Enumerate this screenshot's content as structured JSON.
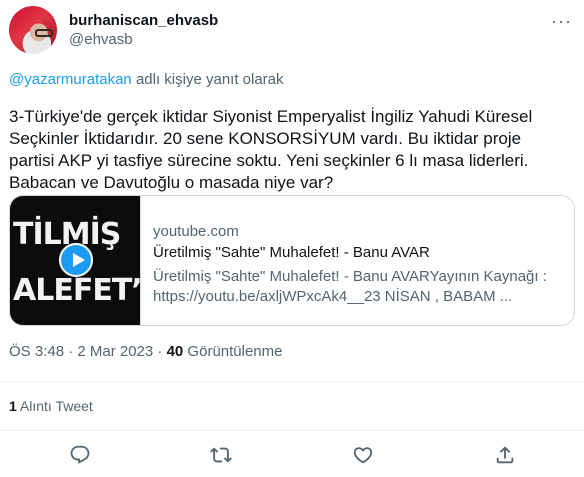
{
  "author": {
    "display_name": "burhaniscan_ehvasb",
    "handle": "@ehvasb"
  },
  "more_icon": "ellipsis-icon",
  "reply_to": {
    "mention": "@yazarmuratakan",
    "suffix": " adlı kişiye yanıt olarak"
  },
  "tweet": {
    "text": "3-Türkiye'de gerçek iktidar Siyonist Emperyalist İngiliz Yahudi Küresel Seçkinler İktidarıdır. 20 sene KONSORSİYUM vardı. Bu iktidar proje partisi AKP yi tasfiye sürecine soktu. Yeni seçkinler 6 lı masa liderleri. Babacan ve Davutoğlu o masada niye var?"
  },
  "card": {
    "thumb_line1": "TİLMİŞ",
    "thumb_line2": "ALEFET’",
    "domain": "youtube.com",
    "title": "Üretilmiş \"Sahte\" Muhalefet! - Banu AVAR",
    "description": "Üretilmiş \"Sahte\" Muhalefet! - Banu AVARYayının Kaynağı : https://youtu.be/axljWPxcAk4__23 NİSAN , BABAM ..."
  },
  "meta": {
    "time_date": "ÖS 3:48 · 2 Mar 2023 · ",
    "views_count": "40",
    "views_label": " Görüntülenme"
  },
  "quotes": {
    "count": "1",
    "label": " Alıntı Tweet"
  },
  "actions": [
    "reply-icon",
    "retweet-icon",
    "like-icon",
    "share-icon"
  ]
}
